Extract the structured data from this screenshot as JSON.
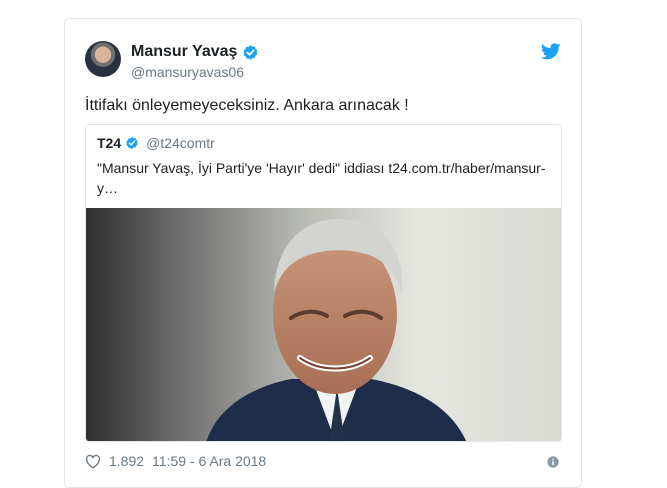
{
  "tweet": {
    "author_name": "Mansur Yavaş",
    "author_handle": "@mansuryavas06",
    "text": "İttifakı önleyemeyeceksiniz. Ankara arınacak !",
    "likes": "1.892",
    "timestamp": "11:59 - 6 Ara 2018"
  },
  "quoted_tweet": {
    "author_name": "T24",
    "author_handle": "@t24comtr",
    "text_line1": "\"Mansur Yavaş, İyi Parti'ye 'Hayır' dedi\" iddiası t24.com.tr/haber/mansur-",
    "text_line2": "y…"
  },
  "icons": {
    "verified": "verified-badge-icon",
    "brand": "twitter-bird-icon",
    "like": "heart-icon",
    "info": "info-icon"
  },
  "colors": {
    "twitter_blue": "#1da1f2",
    "text": "#1c2022",
    "secondary_text": "#697882",
    "border": "#e1e8ed"
  }
}
